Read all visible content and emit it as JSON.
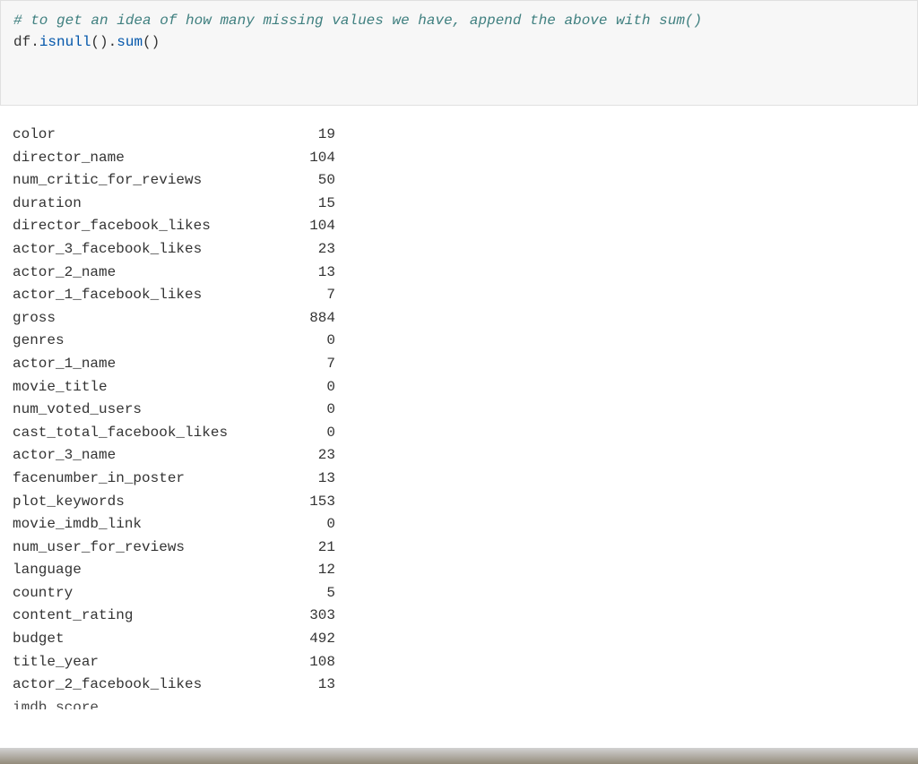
{
  "code": {
    "comment": "# to get an idea of how many missing values we have, append the above with sum()",
    "variable": "df",
    "method1": "isnull",
    "method2": "sum"
  },
  "output": {
    "rows": [
      {
        "name": "color",
        "value": "19"
      },
      {
        "name": "director_name",
        "value": "104"
      },
      {
        "name": "num_critic_for_reviews",
        "value": "50"
      },
      {
        "name": "duration",
        "value": "15"
      },
      {
        "name": "director_facebook_likes",
        "value": "104"
      },
      {
        "name": "actor_3_facebook_likes",
        "value": "23"
      },
      {
        "name": "actor_2_name",
        "value": "13"
      },
      {
        "name": "actor_1_facebook_likes",
        "value": "7"
      },
      {
        "name": "gross",
        "value": "884"
      },
      {
        "name": "genres",
        "value": "0"
      },
      {
        "name": "actor_1_name",
        "value": "7"
      },
      {
        "name": "movie_title",
        "value": "0"
      },
      {
        "name": "num_voted_users",
        "value": "0"
      },
      {
        "name": "cast_total_facebook_likes",
        "value": "0"
      },
      {
        "name": "actor_3_name",
        "value": "23"
      },
      {
        "name": "facenumber_in_poster",
        "value": "13"
      },
      {
        "name": "plot_keywords",
        "value": "153"
      },
      {
        "name": "movie_imdb_link",
        "value": "0"
      },
      {
        "name": "num_user_for_reviews",
        "value": "21"
      },
      {
        "name": "language",
        "value": "12"
      },
      {
        "name": "country",
        "value": "5"
      },
      {
        "name": "content_rating",
        "value": "303"
      },
      {
        "name": "budget",
        "value": "492"
      },
      {
        "name": "title_year",
        "value": "108"
      },
      {
        "name": "actor_2_facebook_likes",
        "value": "13"
      }
    ],
    "partial_row_name": "imdb_score"
  }
}
